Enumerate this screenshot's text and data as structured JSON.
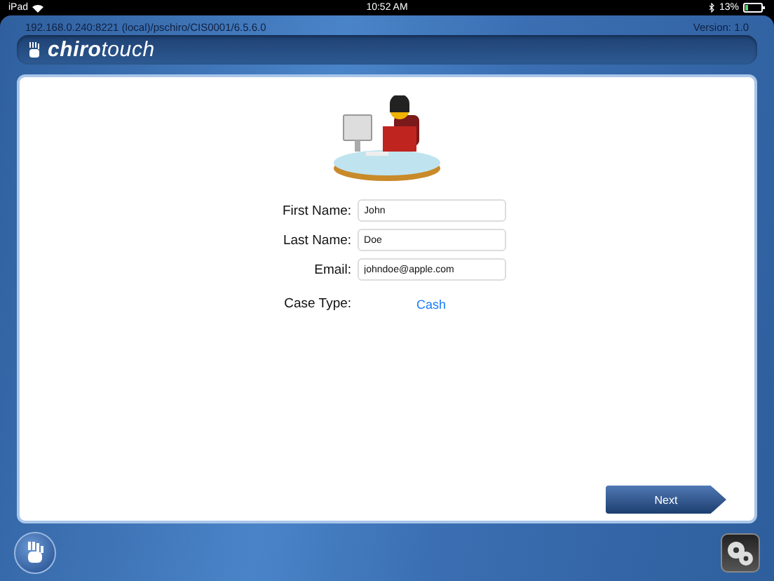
{
  "status_bar": {
    "device": "iPad",
    "time": "10:52 AM",
    "battery": "13%"
  },
  "header": {
    "connection": "192.168.0.240:8221 (local)/pschiro/CIS0001/6.5.6.0",
    "version": "Version: 1.0",
    "logo": {
      "bold": "chiro",
      "light": "touch"
    }
  },
  "form": {
    "fields": [
      {
        "label": "First Name:",
        "value": "John"
      },
      {
        "label": "Last Name:",
        "value": "Doe"
      },
      {
        "label": "Email:",
        "value": "johndoe@apple.com"
      }
    ],
    "case_type": {
      "label": "Case Type:",
      "value": "Cash"
    }
  },
  "buttons": {
    "next": "Next"
  }
}
